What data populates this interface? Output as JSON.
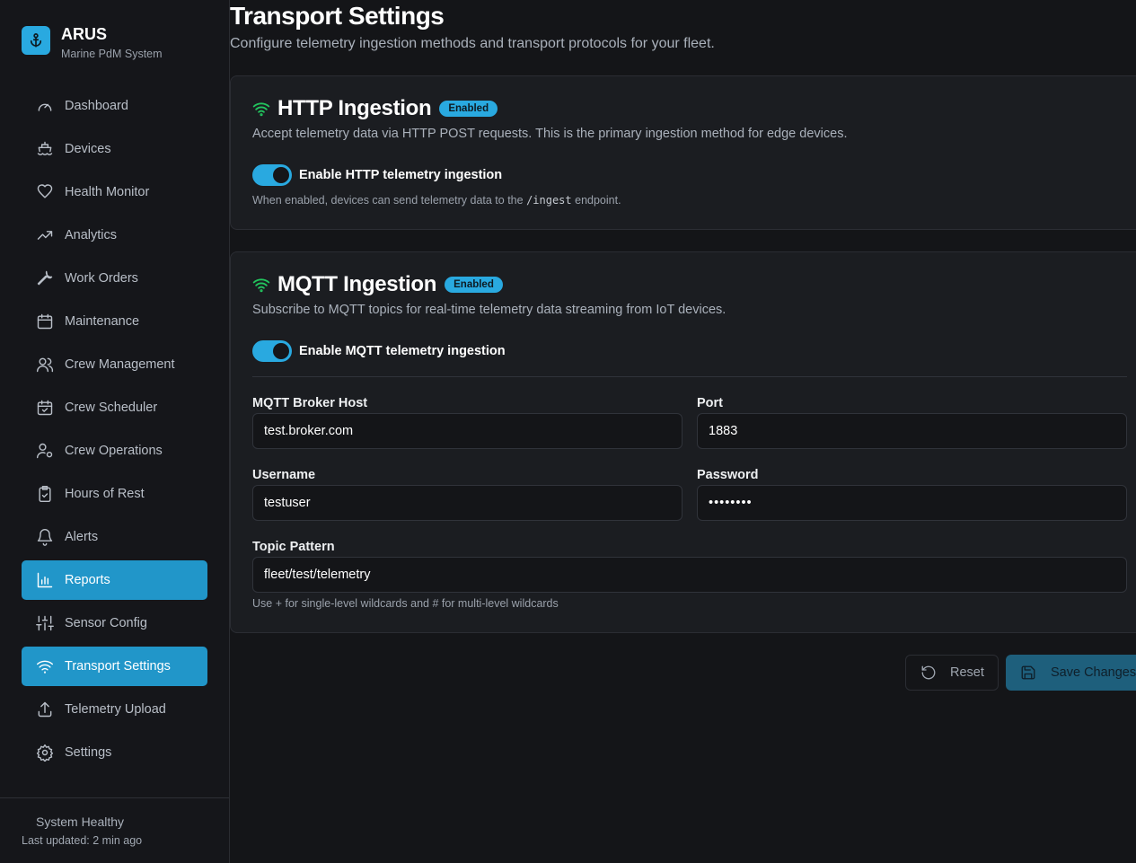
{
  "brand": {
    "name": "ARUS",
    "subtitle": "Marine PdM System"
  },
  "nav": [
    {
      "label": "Dashboard",
      "icon": "gauge-icon"
    },
    {
      "label": "Devices",
      "icon": "ship-icon"
    },
    {
      "label": "Health Monitor",
      "icon": "heart-icon"
    },
    {
      "label": "Analytics",
      "icon": "trending-up-icon"
    },
    {
      "label": "Work Orders",
      "icon": "wrench-icon"
    },
    {
      "label": "Maintenance",
      "icon": "calendar-icon"
    },
    {
      "label": "Crew Management",
      "icon": "users-icon"
    },
    {
      "label": "Crew Scheduler",
      "icon": "calendar-check-icon"
    },
    {
      "label": "Crew Operations",
      "icon": "user-cog-icon"
    },
    {
      "label": "Hours of Rest",
      "icon": "clipboard-check-icon"
    },
    {
      "label": "Alerts",
      "icon": "bell-icon"
    },
    {
      "label": "Reports",
      "icon": "bar-chart-icon",
      "active": true
    },
    {
      "label": "Sensor Config",
      "icon": "sliders-icon"
    },
    {
      "label": "Transport Settings",
      "icon": "wifi-icon",
      "active": true
    },
    {
      "label": "Telemetry Upload",
      "icon": "upload-icon"
    },
    {
      "label": "Settings",
      "icon": "gear-icon"
    }
  ],
  "footer": {
    "status": "System Healthy",
    "updated": "Last updated: 2 min ago"
  },
  "page": {
    "title": "Transport Settings",
    "subtitle": "Configure telemetry ingestion methods and transport protocols for your fleet."
  },
  "http": {
    "title": "HTTP Ingestion",
    "badge": "Enabled",
    "description": "Accept telemetry data via HTTP POST requests. This is the primary ingestion method for edge devices.",
    "toggle_label": "Enable HTTP telemetry ingestion",
    "toggle_on": true,
    "hint_pre": "When enabled, devices can send telemetry data to the",
    "hint_code": "/ingest",
    "hint_post": "endpoint."
  },
  "mqtt": {
    "title": "MQTT Ingestion",
    "badge": "Enabled",
    "description": "Subscribe to MQTT topics for real-time telemetry data streaming from IoT devices.",
    "toggle_label": "Enable MQTT telemetry ingestion",
    "toggle_on": true,
    "host_label": "MQTT Broker Host",
    "host": "test.broker.com",
    "port_label": "Port",
    "port": "1883",
    "username_label": "Username",
    "username": "testuser",
    "password_label": "Password",
    "password": "••••••••",
    "topic_label": "Topic Pattern",
    "topic": "fleet/test/telemetry",
    "topic_hint": "Use + for single-level wildcards and # for multi-level wildcards"
  },
  "actions": {
    "reset": "Reset",
    "save": "Save Changes"
  },
  "colors": {
    "accent": "#2196c9",
    "badge": "#29a9e0",
    "wifi_green": "#22c55e"
  }
}
